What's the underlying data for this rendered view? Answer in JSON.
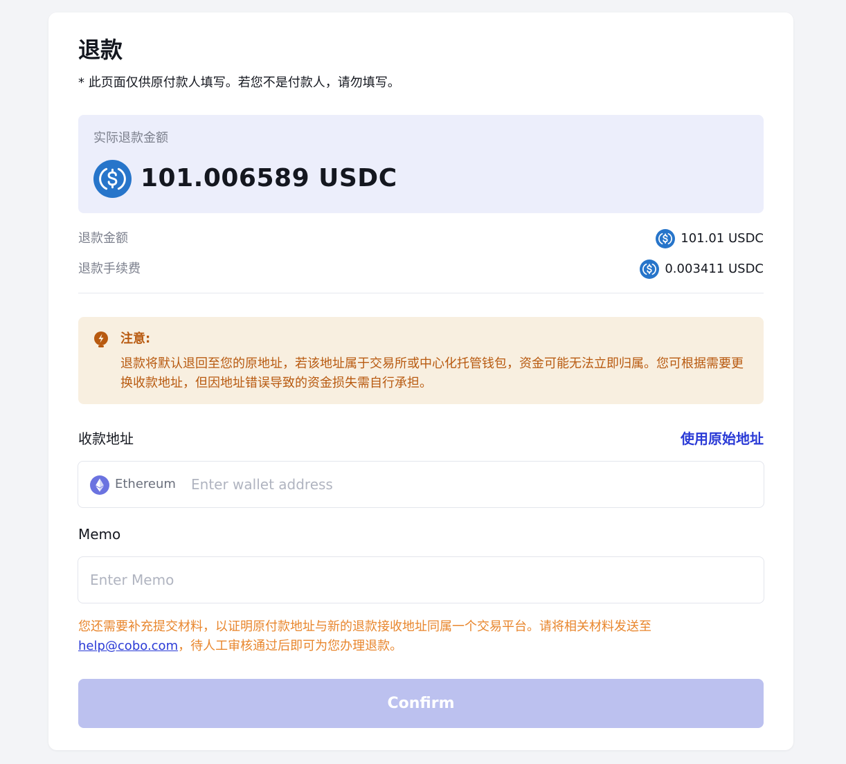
{
  "page": {
    "title": "退款",
    "subtitle": "* 此页面仅供原付款人填写。若您不是付款人，请勿填写。"
  },
  "actual_refund": {
    "label": "实际退款金额",
    "amount": "101.006589 USDC"
  },
  "breakdown": [
    {
      "label": "退款金额",
      "value": "101.01 USDC"
    },
    {
      "label": "退款手续费",
      "value": "0.003411 USDC"
    }
  ],
  "notice": {
    "title": "注意:",
    "body": "退款将默认退回至您的原地址，若该地址属于交易所或中心化托管钱包，资金可能无法立即归属。您可根据需要更换收款地址，但因地址错误导致的资金损失需自行承担。"
  },
  "address_field": {
    "label": "收款地址",
    "use_original": "使用原始地址",
    "chain": "Ethereum",
    "placeholder": "Enter wallet address",
    "value": ""
  },
  "memo_field": {
    "label": "Memo",
    "placeholder": "Enter Memo",
    "value": ""
  },
  "hint": {
    "text_before": "您还需要补充提交材料，以证明原付款地址与新的退款接收地址同属一个交易平台。请将相关材料发送至",
    "email": "help@cobo.com",
    "text_after": "，待人工审核通过后即可为您办理退款。"
  },
  "confirm_label": "Confirm",
  "icons": {
    "coin": "usdc-coin-icon",
    "notice": "lightbulb-icon",
    "chain": "ethereum-icon"
  },
  "colors": {
    "usdc_blue": "#2775ca",
    "accent": "#2a3ad6",
    "notice_bg": "#f8efe0",
    "notice_text": "#b85a10",
    "hint_text": "#e8862d",
    "confirm_disabled": "#bcc1ef",
    "amount_bg": "#eceefb",
    "eth_purple": "#6b73e0"
  }
}
